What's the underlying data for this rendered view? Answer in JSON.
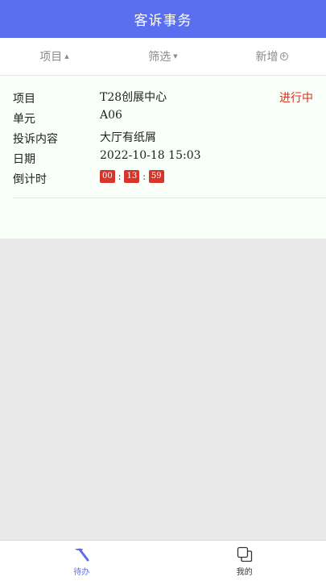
{
  "header": {
    "title": "客诉事务"
  },
  "filters": {
    "project_label": "项目",
    "filter_label": "筛选",
    "add_label": "新增",
    "arrow_up": "▲",
    "arrow_down": "▼",
    "plus": "+"
  },
  "record": {
    "status": "进行中",
    "fields": [
      {
        "label": "项目",
        "value": "T28创展中心"
      },
      {
        "label": "单元",
        "value": "A06"
      },
      {
        "label": "投诉内容",
        "value": "大厅有纸屑"
      },
      {
        "label": "日期",
        "value": "2022-10-18 15:03"
      },
      {
        "label": "倒计时",
        "value": ""
      }
    ],
    "countdown": {
      "hours": "00",
      "minutes": "13",
      "seconds": "59",
      "separator": ":"
    }
  },
  "tabbar": {
    "todo_label": "待办",
    "mine_label": "我的",
    "todo_icon": "pickaxe-icon",
    "mine_icon": "copy-squares-icon"
  },
  "colors": {
    "header_bg": "#5a6ff0",
    "status_red": "#d9301f",
    "countdown_bg": "#d6352b",
    "panel_bg": "#f7fff8"
  }
}
